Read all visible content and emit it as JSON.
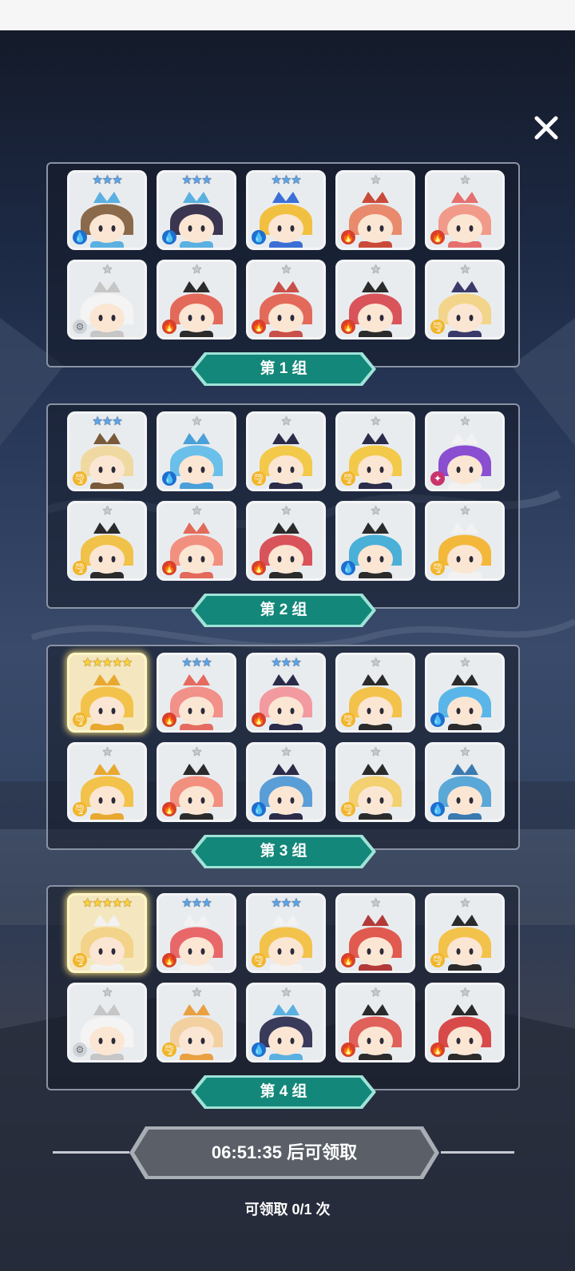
{
  "groups": [
    {
      "label": "第 1 组",
      "heroes": [
        {
          "stars": 3,
          "star_color": "blue",
          "element": "water",
          "color": "#8a6a4a",
          "accent": "#5ab0e0"
        },
        {
          "stars": 3,
          "star_color": "blue",
          "element": "water",
          "color": "#3a3550",
          "accent": "#5ab0e0"
        },
        {
          "stars": 3,
          "star_color": "blue",
          "element": "water",
          "color": "#f2c041",
          "accent": "#3b6fd6"
        },
        {
          "stars": 1,
          "star_color": "grey",
          "element": "fire",
          "color": "#e98a6c",
          "accent": "#c94a38"
        },
        {
          "stars": 1,
          "star_color": "grey",
          "element": "fire",
          "color": "#f19a8a",
          "accent": "#e56f6f"
        },
        {
          "stars": 1,
          "star_color": "grey",
          "element": "earth",
          "color": "#f4f4f4",
          "accent": "#c6c6c6"
        },
        {
          "stars": 1,
          "star_color": "grey",
          "element": "fire",
          "color": "#e36a5a",
          "accent": "#2b2b2b"
        },
        {
          "stars": 1,
          "star_color": "grey",
          "element": "fire",
          "color": "#e36a5a",
          "accent": "#c9504a"
        },
        {
          "stars": 1,
          "star_color": "grey",
          "element": "fire",
          "color": "#d9535a",
          "accent": "#2b2b2b"
        },
        {
          "stars": 1,
          "star_color": "grey",
          "element": "wind",
          "color": "#f2d58a",
          "accent": "#3a3a6a"
        }
      ]
    },
    {
      "label": "第 2 组",
      "heroes": [
        {
          "stars": 3,
          "star_color": "blue",
          "element": "wind",
          "color": "#f0d9a0",
          "accent": "#7a5a3a"
        },
        {
          "stars": 1,
          "star_color": "grey",
          "element": "water",
          "color": "#6ac0ea",
          "accent": "#4aa0d8"
        },
        {
          "stars": 1,
          "star_color": "grey",
          "element": "wind",
          "color": "#f3c94a",
          "accent": "#2b2b4a"
        },
        {
          "stars": 1,
          "star_color": "grey",
          "element": "wind",
          "color": "#f3c94a",
          "accent": "#2b2b4a"
        },
        {
          "stars": 1,
          "star_color": "grey",
          "element": "dark",
          "color": "#8a4ed0",
          "accent": "#f2f2f2"
        },
        {
          "stars": 1,
          "star_color": "grey",
          "element": "wind",
          "color": "#f1c24a",
          "accent": "#2b2b2b"
        },
        {
          "stars": 1,
          "star_color": "grey",
          "element": "fire",
          "color": "#f29080",
          "accent": "#e36a5a"
        },
        {
          "stars": 1,
          "star_color": "grey",
          "element": "fire",
          "color": "#d9535a",
          "accent": "#2b2b2b"
        },
        {
          "stars": 1,
          "star_color": "grey",
          "element": "water",
          "color": "#4ab0d8",
          "accent": "#2b2b2b"
        },
        {
          "stars": 1,
          "star_color": "grey",
          "element": "wind",
          "color": "#f3b83a",
          "accent": "#f2f2f2"
        }
      ]
    },
    {
      "label": "第 3 组",
      "heroes": [
        {
          "stars": 5,
          "star_color": "gold",
          "element": "wind",
          "color": "#f3c24a",
          "accent": "#e8a830",
          "gold": true
        },
        {
          "stars": 3,
          "star_color": "blue",
          "element": "fire",
          "color": "#f2908a",
          "accent": "#e56a60"
        },
        {
          "stars": 3,
          "star_color": "blue",
          "element": "fire",
          "color": "#f29aa0",
          "accent": "#2b2b4a"
        },
        {
          "stars": 1,
          "star_color": "grey",
          "element": "wind",
          "color": "#f3c24a",
          "accent": "#2b2b2b"
        },
        {
          "stars": 1,
          "star_color": "grey",
          "element": "water",
          "color": "#5ab6e8",
          "accent": "#2b2b2b"
        },
        {
          "stars": 1,
          "star_color": "grey",
          "element": "wind",
          "color": "#f3c24a",
          "accent": "#e8a830"
        },
        {
          "stars": 1,
          "star_color": "grey",
          "element": "fire",
          "color": "#f29080",
          "accent": "#2b2b2b"
        },
        {
          "stars": 1,
          "star_color": "grey",
          "element": "water",
          "color": "#5a9ed8",
          "accent": "#2b2b4a"
        },
        {
          "stars": 1,
          "star_color": "grey",
          "element": "wind",
          "color": "#f3d070",
          "accent": "#2b2b2b"
        },
        {
          "stars": 1,
          "star_color": "grey",
          "element": "water",
          "color": "#5aa8d8",
          "accent": "#3a7ab0"
        }
      ]
    },
    {
      "label": "第 4 组",
      "heroes": [
        {
          "stars": 5,
          "star_color": "gold",
          "element": "wind",
          "color": "#f3d38a",
          "accent": "#f2f2f2",
          "gold": true
        },
        {
          "stars": 3,
          "star_color": "blue",
          "element": "fire",
          "color": "#e8686a",
          "accent": "#f2f2f2"
        },
        {
          "stars": 3,
          "star_color": "blue",
          "element": "wind",
          "color": "#f3c24a",
          "accent": "#f2f2f2"
        },
        {
          "stars": 1,
          "star_color": "grey",
          "element": "fire",
          "color": "#e05a50",
          "accent": "#b23a38"
        },
        {
          "stars": 1,
          "star_color": "grey",
          "element": "wind",
          "color": "#f3c24a",
          "accent": "#2b2b2b"
        },
        {
          "stars": 1,
          "star_color": "grey",
          "element": "earth",
          "color": "#f4f4f4",
          "accent": "#c6c6c6"
        },
        {
          "stars": 1,
          "star_color": "grey",
          "element": "wind",
          "color": "#f2d0a0",
          "accent": "#e8a040"
        },
        {
          "stars": 1,
          "star_color": "grey",
          "element": "water",
          "color": "#3a3a5a",
          "accent": "#5ab0e0"
        },
        {
          "stars": 1,
          "star_color": "grey",
          "element": "fire",
          "color": "#e0605a",
          "accent": "#2b2b2b"
        },
        {
          "stars": 1,
          "star_color": "grey",
          "element": "fire",
          "color": "#d84a4a",
          "accent": "#2b2b2b"
        }
      ]
    }
  ],
  "timer_text": "06:51:35 后可领取",
  "claim_text": "可领取 0/1 次",
  "colors": {
    "banner": "#138779",
    "banner_edge": "#9fe3d8",
    "timer_bg": "#5b6068",
    "timer_edge": "#a9aeb5"
  }
}
